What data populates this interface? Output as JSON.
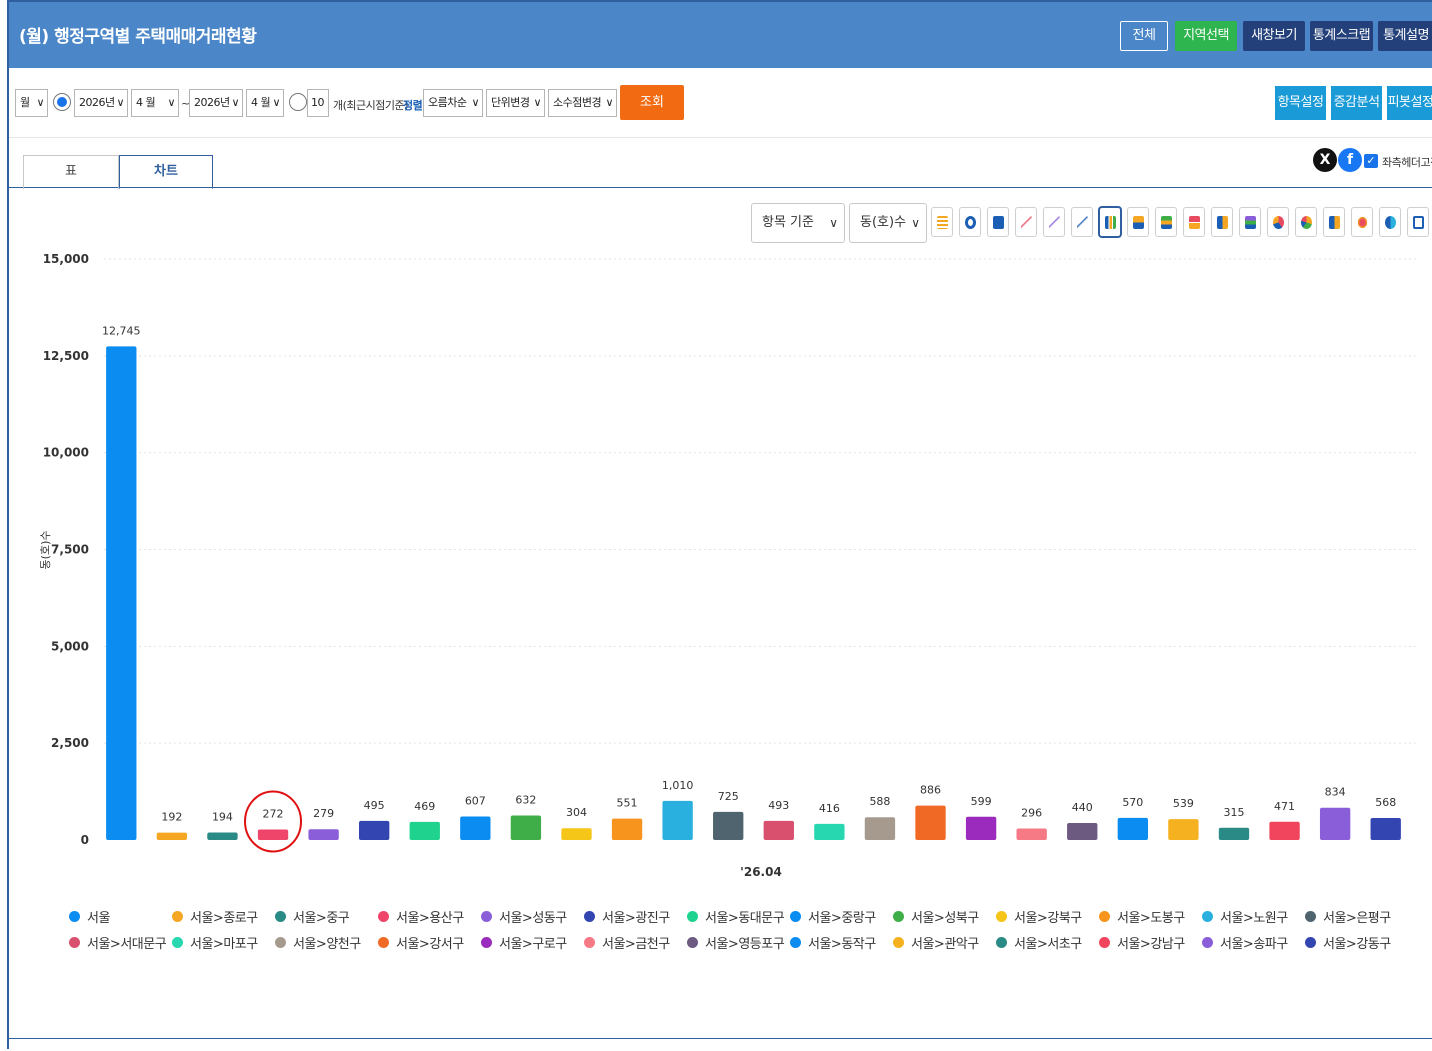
{
  "header": {
    "title": "(월) 행정구역별 주택매매거래현황",
    "buttons": [
      "전체",
      "지역선택",
      "새창보기",
      "통계스크랩",
      "통계설명"
    ]
  },
  "toolbar": {
    "period_type": "월",
    "start_year": "2026년",
    "start_month": "4 월",
    "range_sep": "~",
    "end_year": "2026년",
    "end_month": "4 월",
    "recent_count": "10",
    "recent_label": "개(최근시점기준)",
    "sort_label": "정렬",
    "sort_value": "오름차순",
    "unit_change": "단위변경",
    "decimal_change": "소수점변경",
    "query_button": "조회",
    "right_buttons": [
      "항목설정",
      "증감분석",
      "피봇설정"
    ]
  },
  "tabs": [
    "표",
    "차트"
  ],
  "share": {
    "x_label": "X",
    "fb_label": "f",
    "fix_header": "좌측헤더고정"
  },
  "chart_controls": {
    "basis": "항목 기준",
    "measure": "동(호)수"
  },
  "chart_data": {
    "type": "bar",
    "xlabel": "'26.04",
    "ylabel": "동(호)수",
    "ylim": [
      0,
      15000
    ],
    "yticks": [
      "0",
      "2,500",
      "5,000",
      "7,500",
      "10,000",
      "12,500",
      "15,000"
    ],
    "grid": true,
    "legend_position": "bottom",
    "categories": [
      "서울",
      "서울>종로구",
      "서울>중구",
      "서울>용산구",
      "서울>성동구",
      "서울>광진구",
      "서울>동대문구",
      "서울>중랑구",
      "서울>성북구",
      "서울>강북구",
      "서울>도봉구",
      "서울>노원구",
      "서울>은평구",
      "서울>서대문구",
      "서울>마포구",
      "서울>양천구",
      "서울>강서구",
      "서울>구로구",
      "서울>금천구",
      "서울>영등포구",
      "서울>동작구",
      "서울>관악구",
      "서울>서초구",
      "서울>강남구",
      "서울>송파구",
      "서울>강동구"
    ],
    "values": [
      12745,
      192,
      194,
      272,
      279,
      495,
      469,
      607,
      632,
      304,
      551,
      1010,
      725,
      493,
      416,
      588,
      886,
      599,
      296,
      440,
      570,
      539,
      315,
      471,
      834,
      568
    ],
    "labels": [
      "12,745",
      "192",
      "194",
      "272",
      "279",
      "495",
      "469",
      "607",
      "632",
      "304",
      "551",
      "1,010",
      "725",
      "493",
      "416",
      "588",
      "886",
      "599",
      "296",
      "440",
      "570",
      "539",
      "315",
      "471",
      "834",
      "568"
    ],
    "colors": [
      "#0a8cf0",
      "#f5a623",
      "#2a8a85",
      "#f0456a",
      "#8a5ed8",
      "#3345b0",
      "#1fd38f",
      "#0a8cf0",
      "#3fae49",
      "#f5c518",
      "#f7941d",
      "#2ab0de",
      "#506470",
      "#d9506e",
      "#27d7b0",
      "#a69a8e",
      "#f06a25",
      "#9b2bbd",
      "#f57a86",
      "#6c5a80",
      "#0a8cf0",
      "#f5b11f",
      "#2a8a85",
      "#f0455c",
      "#8a5ed8",
      "#3345b0"
    ],
    "highlight_index": 3,
    "highlight_color": "#e01010"
  }
}
